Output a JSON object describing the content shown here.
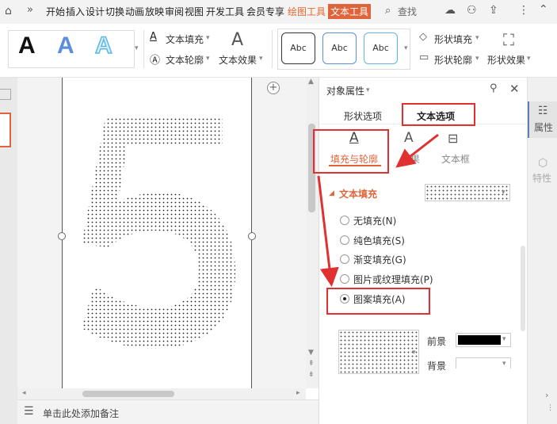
{
  "menubar": {
    "items": [
      "开始",
      "插入",
      "设计",
      "切换",
      "动画",
      "放映",
      "审阅",
      "视图",
      "开发工具",
      "会员专享",
      "绘图工具",
      "文本工具"
    ],
    "search": "查找"
  },
  "ribbon": {
    "text_fill": "文本填充",
    "text_outline": "文本轮廓",
    "text_effect": "文本效果",
    "shape_fill": "形状填充",
    "shape_outline": "形状轮廓",
    "shape_effect": "形状效果",
    "style_letter": "A",
    "abc": "Abc"
  },
  "canvas": {
    "digit": "5",
    "notes_placeholder": "单击此处添加备注"
  },
  "panel": {
    "title": "对象属性",
    "tab_shape": "形状选项",
    "tab_text": "文本选项",
    "sub_fill": "填充与轮廓",
    "sub_effect": "效果",
    "sub_textbox": "文本框",
    "section": "文本填充",
    "options": [
      "无填充(N)",
      "纯色填充(S)",
      "渐变填充(G)",
      "图片或纹理填充(P)",
      "图案填充(A)"
    ],
    "fg_label": "前景",
    "bg_label": "背景"
  },
  "side": {
    "props": "属性",
    "traits": "特性"
  }
}
